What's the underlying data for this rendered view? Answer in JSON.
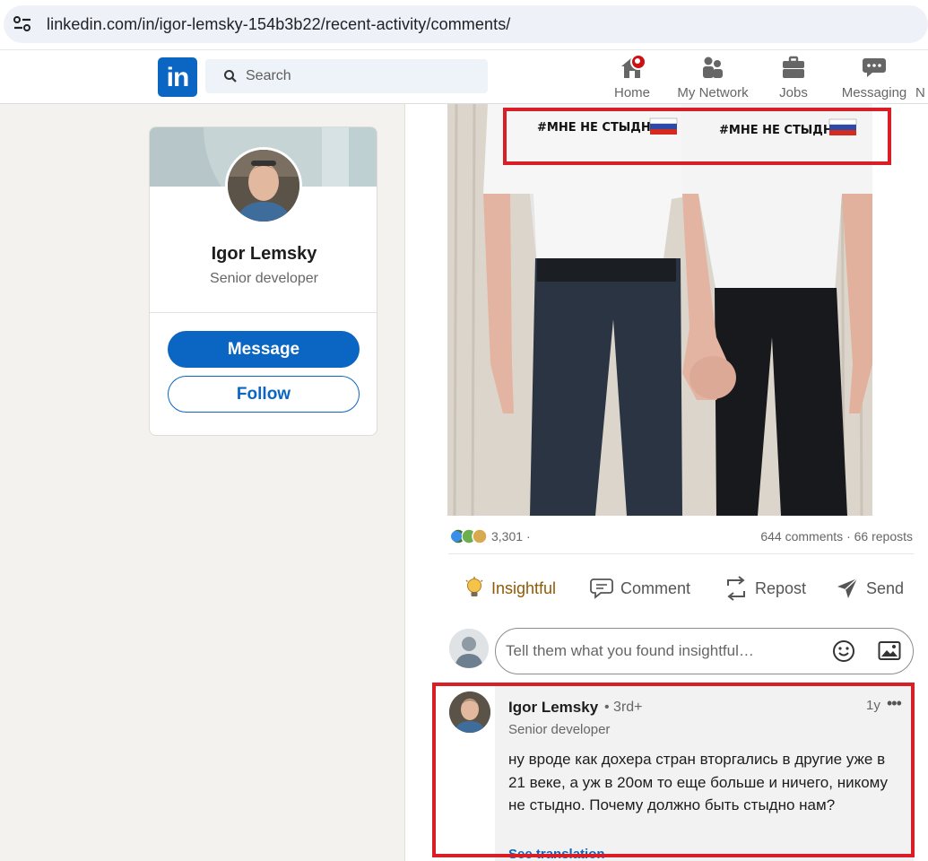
{
  "browser": {
    "url": "linkedin.com/in/igor-lemsky-154b3b22/recent-activity/comments/",
    "site_info_icon": "site-settings-icon"
  },
  "nav": {
    "logo_text": "in",
    "search_placeholder": "Search",
    "items": [
      {
        "label": "Home",
        "icon": "home-icon",
        "has_badge": true
      },
      {
        "label": "My Network",
        "icon": "network-icon"
      },
      {
        "label": "Jobs",
        "icon": "briefcase-icon"
      },
      {
        "label": "Messaging",
        "icon": "messaging-icon"
      },
      {
        "label": "N",
        "icon": "notifications-icon"
      }
    ],
    "accent_color": "#0a66c2",
    "badge_color": "#cc1016"
  },
  "profile": {
    "name": "Igor Lemsky",
    "headline": "Senior developer",
    "message_label": "Message",
    "follow_label": "Follow"
  },
  "post": {
    "image_caption_text": "#МНЕ НЕ СТЫДНО",
    "reactions": {
      "icons": [
        "celebrate-icon",
        "support-icon",
        "insightful-icon"
      ],
      "count": "3,301",
      "separator": "·"
    },
    "comments_reposts": "644 comments · 66 reposts",
    "actions": [
      {
        "label": "Insightful",
        "icon": "lightbulb-icon",
        "active": true
      },
      {
        "label": "Comment",
        "icon": "comment-icon"
      },
      {
        "label": "Repost",
        "icon": "repost-icon"
      },
      {
        "label": "Send",
        "icon": "send-icon"
      }
    ],
    "comment_placeholder": "Tell them what you found insightful…"
  },
  "comment": {
    "author": "Igor Lemsky",
    "degree": "• 3rd+",
    "headline": "Senior developer",
    "time": "1y",
    "more": "•••",
    "text": "ну вроде как дохера стран вторгались в другие уже в 21 веке, а уж в 20ом то еще больше и ничего, никому не стыдно. Почему должно быть стыдно нам?",
    "see_translation": "See translation"
  },
  "highlight_color": "#d91e26"
}
